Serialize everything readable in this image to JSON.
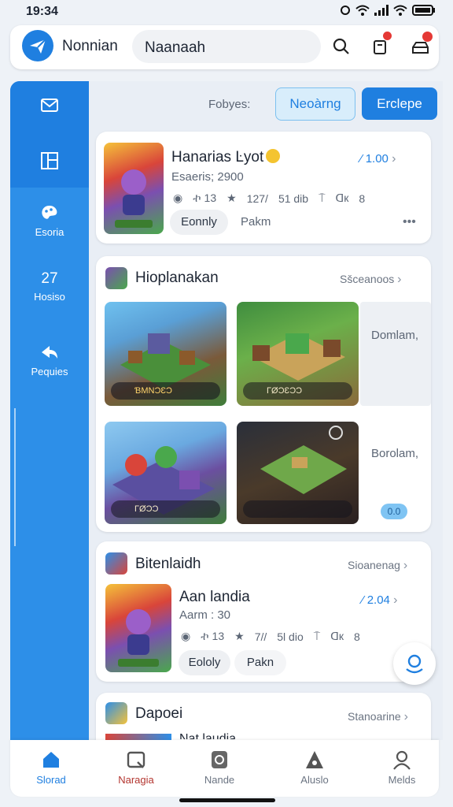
{
  "status": {
    "time": "19:34"
  },
  "header": {
    "app_name": "Nonnian",
    "search_value": "Naanaah"
  },
  "colors": {
    "accent": "#1f7fe0",
    "sidebar": "#2d8fe8",
    "badge": "#e53935"
  },
  "sidebar": {
    "items": [
      {
        "icon": "mail-send-icon",
        "label": ""
      },
      {
        "icon": "layout-icon",
        "label": ""
      },
      {
        "icon": "palette-icon",
        "label": "Esoria"
      },
      {
        "icon": "stats-icon",
        "label": "Hosiso",
        "value": "27"
      },
      {
        "icon": "share-icon",
        "label": "Pequies"
      }
    ]
  },
  "filter": {
    "label": "Fobyes:",
    "option_outline": "Neoàrng",
    "option_solid": "Erclepe"
  },
  "featured": {
    "title": "Hanarias Ŀyot",
    "subtitle": "Esaeris; 2900",
    "price": "1.00",
    "meta": {
      "views": "ኯ 13",
      "rating": "127/",
      "extra": "51 dib",
      "count": "8"
    },
    "pill": "Eonnly",
    "secondary": "Pakm"
  },
  "section1": {
    "title": "Hioplanakan",
    "link": "Sšceanoos",
    "tiles": [
      {
        "caption": "ƁMNƆƐƆ"
      },
      {
        "caption": "ΓØƆƐƆƆ"
      },
      {
        "caption": "ΓØƆƆ"
      },
      {
        "caption": ""
      }
    ],
    "side_labels": [
      "Domlam,",
      "Borolam,"
    ],
    "badge": "0.0"
  },
  "section2": {
    "title": "Bitenlaidh",
    "link": "Sioanenag",
    "item": {
      "title": "Aan landia",
      "subtitle": "Aarm : 30",
      "price": "2.04",
      "meta": {
        "views": "ኯ 13",
        "rating": "7//",
        "extra": "5l dio",
        "count": "8"
      },
      "pill": "Eololy",
      "secondary": "Pakn"
    }
  },
  "section3": {
    "title": "Dapoei",
    "link": "Stanoarine",
    "peek": "Nat laudia"
  },
  "bottom_nav": [
    {
      "icon": "home-icon",
      "label": "Slorad",
      "active": true
    },
    {
      "icon": "discover-icon",
      "label": "Naragia"
    },
    {
      "icon": "bookmark-icon",
      "label": "Nande"
    },
    {
      "icon": "triangle-icon",
      "label": "Aluslo"
    },
    {
      "icon": "user-icon",
      "label": "Melds"
    }
  ]
}
